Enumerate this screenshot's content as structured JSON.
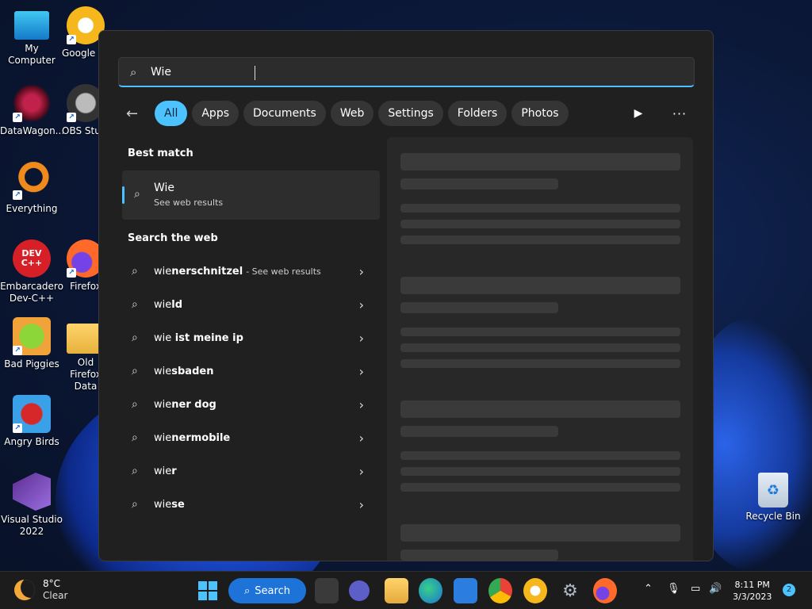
{
  "desktop": {
    "icons": [
      {
        "label": "My Computer"
      },
      {
        "label": "Google Chrome"
      },
      {
        "label": "DataWagon..."
      },
      {
        "label": "OBS Studio"
      },
      {
        "label": "Everything"
      },
      {
        "label": "Embarcadero Dev-C++"
      },
      {
        "label": "Firefox"
      },
      {
        "label": "Bad Piggies"
      },
      {
        "label": "Old Firefox Data"
      },
      {
        "label": "Angry Birds"
      },
      {
        "label": "Visual Studio 2022"
      }
    ],
    "recycle_bin": "Recycle Bin",
    "devcpp_glyph": "DEV C++"
  },
  "search": {
    "query": "Wie",
    "filters": [
      "All",
      "Apps",
      "Documents",
      "Web",
      "Settings",
      "Folders",
      "Photos"
    ],
    "best_match_heading": "Best match",
    "best_match": {
      "title": "Wie",
      "subtitle": "See web results"
    },
    "web_heading": "Search the web",
    "web_results": [
      {
        "prefix": "wie",
        "rest": "nerschnitzel",
        "hint": "- See web results"
      },
      {
        "prefix": "wie",
        "rest": "ld",
        "hint": ""
      },
      {
        "prefix": "wie",
        "rest": " ist meine ip",
        "hint": ""
      },
      {
        "prefix": "wie",
        "rest": "sbaden",
        "hint": ""
      },
      {
        "prefix": "wie",
        "rest": "ner dog",
        "hint": ""
      },
      {
        "prefix": "wie",
        "rest": "nermobile",
        "hint": ""
      },
      {
        "prefix": "wie",
        "rest": "r",
        "hint": ""
      },
      {
        "prefix": "wie",
        "rest": "se",
        "hint": ""
      }
    ]
  },
  "taskbar": {
    "weather_temp": "8°C",
    "weather_cond": "Clear",
    "search_label": "Search",
    "time": "8:11 PM",
    "date": "3/3/2023",
    "notifications": "2"
  },
  "colors": {
    "accent": "#4cc2ff",
    "panel": "#202020",
    "taskbar": "#1c1c1c"
  }
}
